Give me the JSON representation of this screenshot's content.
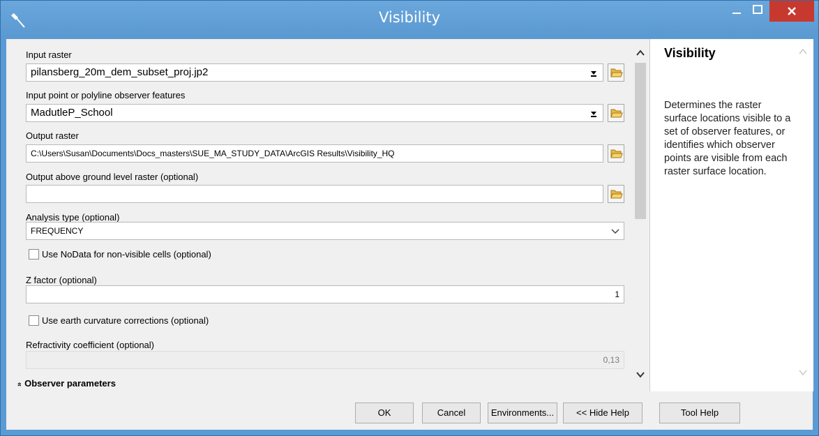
{
  "window": {
    "title": "Visibility"
  },
  "form": {
    "input_raster": {
      "label": "Input raster",
      "value": "pilansberg_20m_dem_subset_proj.jp2"
    },
    "observer_features": {
      "label": "Input point or polyline observer features",
      "value": "MadutleP_School"
    },
    "output_raster": {
      "label": "Output raster",
      "value": "C:\\Users\\Susan\\Documents\\Docs_masters\\SUE_MA_STUDY_DATA\\ArcGIS Results\\Visibility_HQ"
    },
    "output_agl": {
      "label": "Output above ground level raster (optional)",
      "value": ""
    },
    "analysis_type": {
      "label": "Analysis type (optional)",
      "value": "FREQUENCY"
    },
    "nodata_checkbox": {
      "label": "Use NoData for non-visible cells (optional)",
      "checked": false
    },
    "z_factor": {
      "label": "Z factor (optional)",
      "value": "1"
    },
    "earth_curvature_checkbox": {
      "label": "Use earth curvature corrections (optional)",
      "checked": false
    },
    "refractivity": {
      "label": "Refractivity coefficient (optional)",
      "value": "0,13"
    },
    "observer_section": {
      "label": "Observer parameters",
      "toggle_glyph": "»"
    }
  },
  "buttons": {
    "ok": "OK",
    "cancel": "Cancel",
    "environments": "Environments...",
    "hide_help": "<< Hide Help",
    "tool_help": "Tool Help"
  },
  "help": {
    "title": "Visibility",
    "text": "Determines the raster surface locations visible to a set of observer features, or identifies which observer points are visible from each raster surface location."
  },
  "icons": [
    "hammer-icon",
    "minimize-icon",
    "maximize-icon",
    "close-icon",
    "dropdown-arrow-icon",
    "folder-open-icon",
    "scroll-up-icon",
    "scroll-down-icon",
    "chevron-down-icon"
  ]
}
